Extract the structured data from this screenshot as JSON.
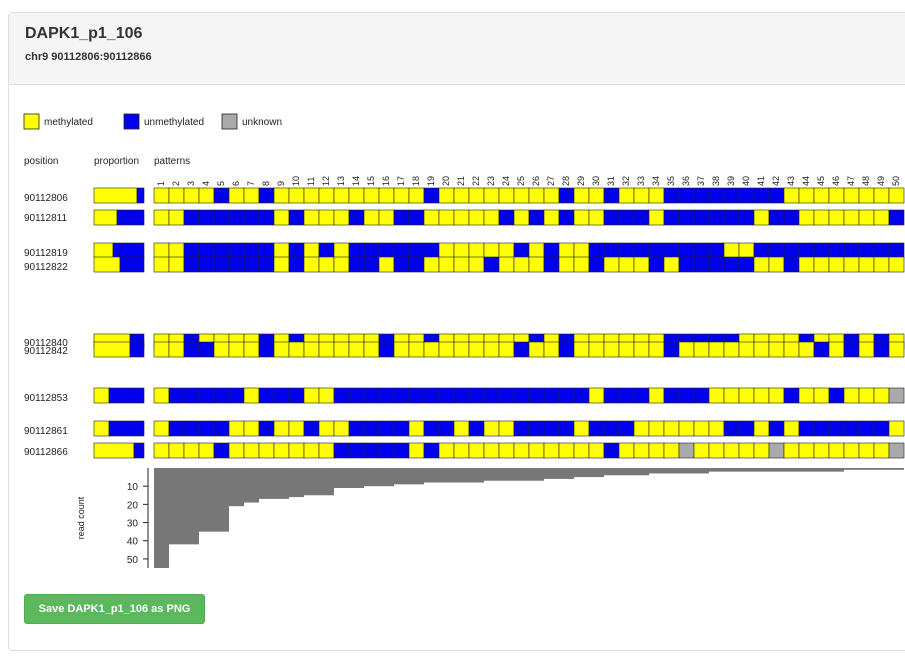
{
  "header": {
    "title": "DAPK1_p1_106",
    "subtitle": "chr9 90112806:90112866"
  },
  "legend": [
    {
      "label": "methylated",
      "color": "#ffff00"
    },
    {
      "label": "unmethylated",
      "color": "#0000ee"
    },
    {
      "label": "unknown",
      "color": "#aaaaaa"
    }
  ],
  "columns": {
    "position": "position",
    "proportion": "proportion",
    "patterns": "patterns"
  },
  "pattern_numbers": [
    "1",
    "2",
    "3",
    "4",
    "5",
    "6",
    "7",
    "8",
    "9",
    "10",
    "11",
    "12",
    "13",
    "14",
    "15",
    "16",
    "17",
    "18",
    "19",
    "20",
    "21",
    "22",
    "23",
    "24",
    "25",
    "26",
    "27",
    "28",
    "29",
    "30",
    "31",
    "32",
    "33",
    "34",
    "35",
    "36",
    "37",
    "38",
    "39",
    "40",
    "41",
    "42",
    "43",
    "44",
    "45",
    "46",
    "47",
    "48",
    "49",
    "50"
  ],
  "positions": [
    {
      "label": "90112806",
      "methylated_fraction": 0.85,
      "pattern": "MMMMUMMUMMMMMMMMMMUMMMMMMMMUMMUMMMUUUUUUUUMMMMMMMM"
    },
    {
      "label": "90112811",
      "methylated_fraction": 0.45,
      "pattern": "MMUUUUUUMUMMMUMMUUMMMMMUMUMUMMUUUMUUUUUUMUUMMMMMMU"
    },
    {
      "label": "90112819",
      "methylated_fraction": 0.38,
      "pattern": "MMUUUUUUMUMUMUUUUUUMMMMMUMUMMUUUUUUUUUMMUUUUUUUUUU"
    },
    {
      "label": "90112822",
      "methylated_fraction": 0.52,
      "pattern": "MMUUUUUUMUMMMUUMUUMMMMUMMMUMMUMMMUMUUUUUMMUMMMMMMM"
    },
    {
      "label": "90112840",
      "methylated_fraction": 0.72,
      "pattern": "MMUMMMMUMUMMMMMUMMUMMMMMMUMUMMMMMMUUUUUMMMMUMMUMUM"
    },
    {
      "label": "90112842",
      "methylated_fraction": 0.72,
      "pattern": "MMUUMMMUMMMMMMMUMMMMMMMMUMMUMMMMMMUMMMMMMMMMUMUMUM"
    },
    {
      "label": "90112853",
      "methylated_fraction": 0.3,
      "pattern": "MUUUUUMUUUMMUUUUUUUUUUUUUUUUUMUUUMUUUMMMMMUMMUMMMX"
    },
    {
      "label": "90112861",
      "methylated_fraction": 0.3,
      "pattern": "MUUUUMMUMMUMMUUUUMUUMUMMUUUUMUUUMMMMMMUUMUMUUUUUUM"
    },
    {
      "label": "90112866",
      "methylated_fraction": 0.8,
      "pattern": "MMMMUMMMMMMMUUUUUMUMMMMMMMMMMMUMMMMXMMMMMXMMMMMMMX"
    }
  ],
  "read_count": {
    "axis_label": "read count",
    "ticks": [
      "10",
      "20",
      "30",
      "40",
      "50"
    ],
    "max": 55,
    "values": [
      55,
      42,
      42,
      35,
      35,
      21,
      19,
      17,
      17,
      16,
      15,
      15,
      11,
      11,
      10,
      10,
      9,
      9,
      8,
      8,
      8,
      8,
      7,
      7,
      7,
      7,
      6,
      6,
      5,
      5,
      4,
      4,
      4,
      3,
      3,
      3,
      3,
      2,
      2,
      2,
      2,
      2,
      2,
      2,
      2,
      2,
      1,
      1,
      1,
      1
    ]
  },
  "save_button": "Save DAPK1_p1_106 as PNG"
}
